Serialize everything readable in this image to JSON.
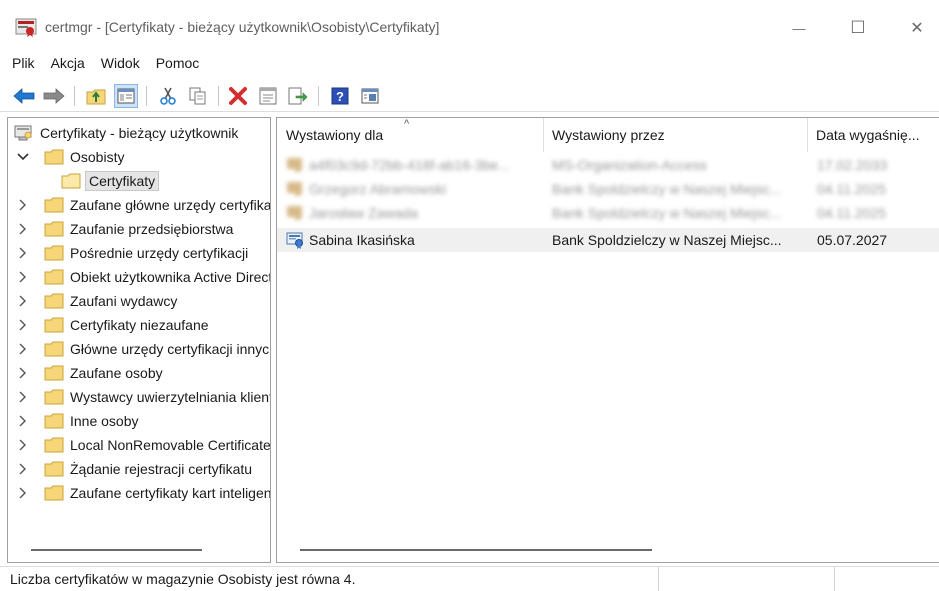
{
  "window": {
    "title": "certmgr - [Certyfikaty - bieżący użytkownik\\Osobisty\\Certyfikaty]",
    "minimize_glyph": "—",
    "maximize_glyph": "☐",
    "close_glyph": "✕"
  },
  "menu": {
    "items": [
      "Plik",
      "Akcja",
      "Widok",
      "Pomoc"
    ]
  },
  "toolbar": {
    "buttons": [
      "back-icon",
      "forward-icon",
      "up-folder-icon",
      "show-hide-tree-icon",
      "cut-icon",
      "copy-icon",
      "delete-icon",
      "properties-icon",
      "export-icon",
      "help-icon",
      "details-view-icon"
    ]
  },
  "tree": {
    "root": "Certyfikaty - bieżący użytkownik",
    "items": [
      {
        "label": "Osobisty",
        "expanded": true
      },
      {
        "label": "Certyfikaty",
        "selected": true
      },
      {
        "label": "Zaufane główne urzędy certyfikacji"
      },
      {
        "label": "Zaufanie przedsiębiorstwa"
      },
      {
        "label": "Pośrednie urzędy certyfikacji"
      },
      {
        "label": "Obiekt użytkownika Active Directory"
      },
      {
        "label": "Zaufani wydawcy"
      },
      {
        "label": "Certyfikaty niezaufane"
      },
      {
        "label": "Główne urzędy certyfikacji innych firm"
      },
      {
        "label": "Zaufane osoby"
      },
      {
        "label": "Wystawcy uwierzytelniania klientów"
      },
      {
        "label": "Inne osoby"
      },
      {
        "label": "Local NonRemovable Certificates"
      },
      {
        "label": "Żądanie rejestracji certyfikatu"
      },
      {
        "label": "Zaufane certyfikaty kart inteligentnych"
      }
    ]
  },
  "list": {
    "columns": [
      "Wystawiony dla",
      "Wystawiony przez",
      "Data wygaśnię..."
    ],
    "sort_indicator": "^",
    "rows": [
      {
        "issued_to": "a4f03c9d-72bb-418f-ab16-3be...",
        "issued_by": "MS-Organization-Access",
        "expires": "17.02.2033",
        "blurred": true
      },
      {
        "issued_to": "Grzegorz Abramowski",
        "issued_by": "Bank Spoldzielczy w Naszej Miejsc...",
        "expires": "04.11.2025",
        "blurred": true
      },
      {
        "issued_to": "Jarosław Zawada",
        "issued_by": "Bank Spoldzielczy w Naszej Miejsc...",
        "expires": "04.11.2025",
        "blurred": true
      },
      {
        "issued_to": "Sabina Ikasińska",
        "issued_by": "Bank Spoldzielczy w Naszej Miejsc...",
        "expires": "05.07.2027",
        "blurred": false
      }
    ]
  },
  "status": {
    "text": "Liczba certyfikatów w magazynie Osobisty jest równa 4."
  },
  "colors": {
    "folder": "#f5d77a",
    "folder_edge": "#c9a33c",
    "delete_red": "#d32f2f",
    "arrow_blue": "#1f78d1",
    "help_blue": "#2a4fb8"
  }
}
